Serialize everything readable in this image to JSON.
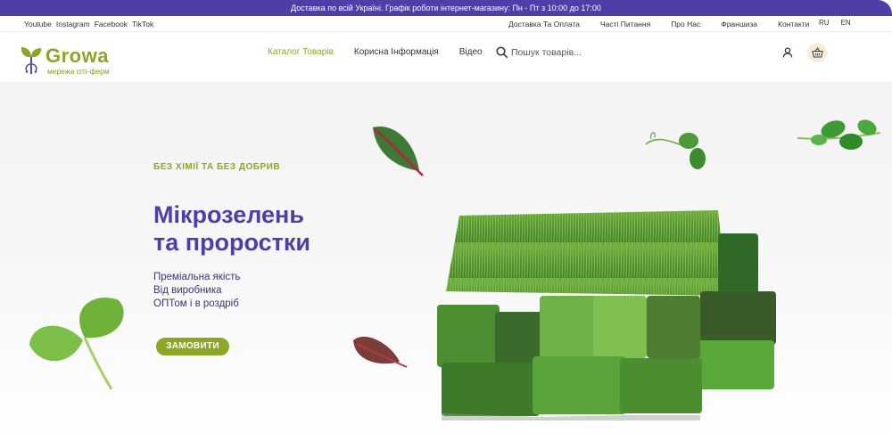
{
  "announcement": "Доставка по всій Україні. Графік роботи інтернет-магазину: Пн - Пт з 10:00 до 17:00",
  "social": [
    "Youtube",
    "Instagram",
    "Facebook",
    "TikTok"
  ],
  "top_links": [
    "Доставка Та Оплата",
    "Часті Питання",
    "Про Нас",
    "Франшиза",
    "Контакти"
  ],
  "languages": [
    "RU",
    "EN"
  ],
  "logo": {
    "brand": "Growa",
    "subtitle": "мережа сіті-ферм"
  },
  "nav": [
    "Каталог Товарів",
    "Корисна Інформація",
    "Відео"
  ],
  "nav_active": 0,
  "search": {
    "placeholder": "Пошук товарів..."
  },
  "icons": {
    "user": "user-icon",
    "cart": "basket-icon",
    "search": "search-icon"
  },
  "hero": {
    "tagline": "БЕЗ ХІМІЇ ТА БЕЗ ДОБРИВ",
    "title_line1": "Мікрозелень",
    "title_line2": "та проростки",
    "features": [
      "Преміальна якість",
      "Від виробника",
      "ОПТом і в роздріб"
    ],
    "cta": "ЗАМОВИТИ"
  },
  "colors": {
    "brand_purple": "#4d3fa6",
    "brand_green": "#8aa728",
    "cart_bg": "#f5ecd8"
  }
}
